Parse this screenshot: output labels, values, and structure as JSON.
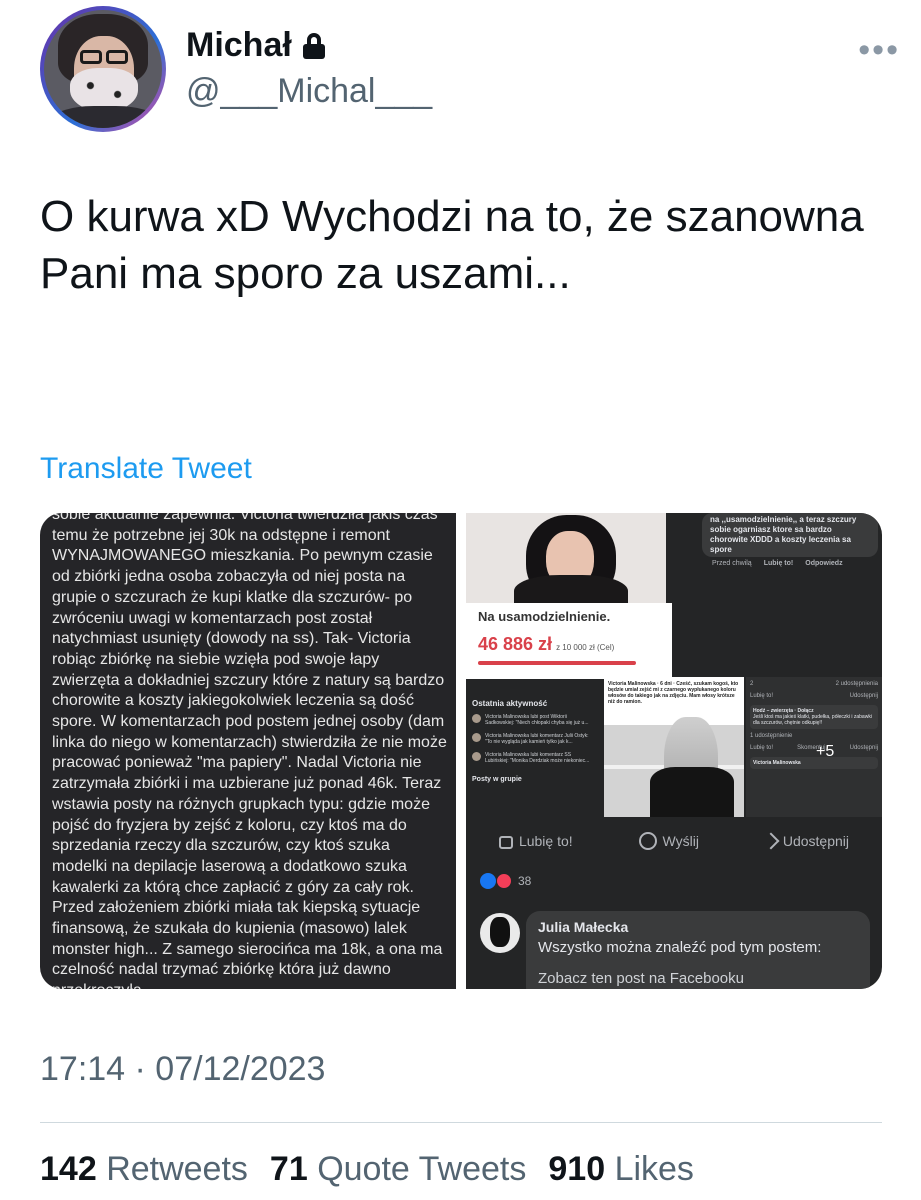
{
  "user": {
    "name": "Michał",
    "handle": "@___Michal___",
    "protected_icon": "lock-icon"
  },
  "tweet": {
    "text": "O kurwa xD Wychodzi na to, że szanowna Pani ma sporo za uszami...",
    "translate_label": "Translate Tweet",
    "timestamp": "17:14 · 07/12/2023"
  },
  "stats": {
    "retweets_count": "142",
    "retweets_label": "Retweets",
    "quotes_count": "71",
    "quotes_label": "Quote Tweets",
    "likes_count": "910",
    "likes_label": "Likes"
  },
  "media": {
    "left_screenshot_text": "sobie aktualnie zapewnia. Victoria twierdziła jakiś czas temu że potrzebne jej 30k na odstępne i remont WYNAJMOWANEGO mieszkania. Po pewnym czasie od zbiórki jedna osoba zobaczyła od niej posta na grupie o szczurach że kupi klatke dla szczurów- po zwróceniu uwagi w komentarzach post został natychmiast usunięty (dowody na ss). Tak- Victoria robiąc zbiórkę na siebie wzięła pod swoje łapy zwierzęta a dokładniej szczury które z natury są bardzo chorowite a koszty jakiegokolwiek leczenia są dość spore. W komentarzach pod postem jednej osoby (dam linka do niego w komentarzach) stwierdziła że nie może pracować ponieważ \"ma papiery\". Nadal Victoria nie zatrzymała zbiórki i ma uzbierane już ponad 46k. Teraz wstawia posty na różnych grupkach typu: gdzie może pojść do fryzjera by zejść z koloru, czy ktoś ma do sprzedania rzeczy dla szczurów, czy ktoś szuka modelki na depilacje laserową a dodatkowo szuka kawalerki za którą chce zapłacić z góry za cały rok. Przed założeniem zbiórki miała tak kiepską sytuacje finansową, że szukała do kupienia (masowo) lalek monster high... Z samego sierocińca ma 18k, a ona ma czelność nadal trzymać zbiórkę która już dawno przekroczyła",
    "fundraiser": {
      "title": "Na usamodzielnienie.",
      "amount": "46 886 zł",
      "goal": "z 10 000 zł (Cel)"
    },
    "comment": {
      "text": "na ,,usamodzielnienie,, a teraz szczury sobie ogarniasz ktore sa bardzo chorowite XDDD a koszty leczenia sa spore",
      "time": "Przed chwilą",
      "like": "Lubię to!",
      "reply": "Odpowiedz"
    },
    "activity": {
      "title": "Ostatnia aktywność",
      "items": [
        "Victoria Malinowska lubi post Wiktorii Sadkowskiej: \"Niech chłopaki chyba się już u...",
        "Victoria Malinowska lubi komentarz Julii Ostyk: \"To nie wygląda jak kamień tylko jak k...",
        "Victoria Malinowska lubi komentarz SS Lubińskiej: \"Monika Derdziak może niekoniec..."
      ],
      "posts_label": "Posty w grupie"
    },
    "snap2_caption": "Victoria Malinowska · 6 dni · Cześć, szukam kogoś, kto będzie umiał zejść mi z czarnego wypłukanego koloru włosów do takiego jak na zdjęciu. Mam włosy krótsze niż do ramion.",
    "snap3": {
      "count_left": "2",
      "count_right": "2 udostępnienia",
      "like": "Lubię to!",
      "share": "Udostępnij",
      "group": "Hodź – zwierzęta · Dołącz",
      "post": "Jeśli ktoś ma jakieś klatki, pudełka, półeczki i zabawki dla szczurów, chętnie odkupię!!",
      "shares": "1 udostępnienie",
      "comment": "Skomentuj",
      "author": "Victoria Malinowska",
      "plus": "+5"
    },
    "actions": {
      "like": "Lubię to!",
      "send": "Wyślij",
      "share": "Udostępnij"
    },
    "reactions_count": "38",
    "julia": {
      "name": "Julia Małecka",
      "text": "Wszystko można znaleźć pod tym postem:",
      "link": "Zobacz ten post na Facebooku"
    }
  }
}
